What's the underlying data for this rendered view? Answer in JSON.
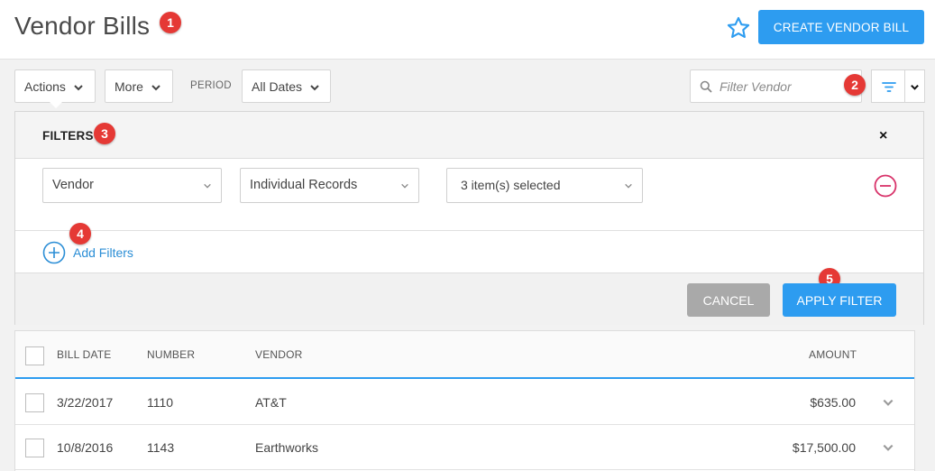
{
  "header": {
    "title": "Vendor Bills",
    "create_button": "CREATE VENDOR BILL",
    "star_icon": "star-icon",
    "accent_color": "#2d9cf0"
  },
  "callouts": [
    "1",
    "2",
    "3",
    "4",
    "5"
  ],
  "toolbar": {
    "actions_label": "Actions",
    "more_label": "More",
    "period_label": "PERIOD",
    "period_value": "All Dates",
    "search_placeholder": "Filter Vendor"
  },
  "filters": {
    "title": "FILTERS",
    "close_label": "×",
    "rows": [
      {
        "field": "Vendor",
        "mode": "Individual Records",
        "value": "3 item(s) selected"
      }
    ],
    "add_filters_label": "Add Filters",
    "cancel_label": "CANCEL",
    "apply_label": "APPLY FILTER"
  },
  "table": {
    "columns": [
      "BILL DATE",
      "NUMBER",
      "VENDOR",
      "AMOUNT"
    ],
    "rows": [
      {
        "bill_date": "3/22/2017",
        "number": "1110",
        "vendor": "AT&T",
        "amount": "$635.00"
      },
      {
        "bill_date": "10/8/2016",
        "number": "1143",
        "vendor": "Earthworks",
        "amount": "$17,500.00"
      }
    ]
  }
}
